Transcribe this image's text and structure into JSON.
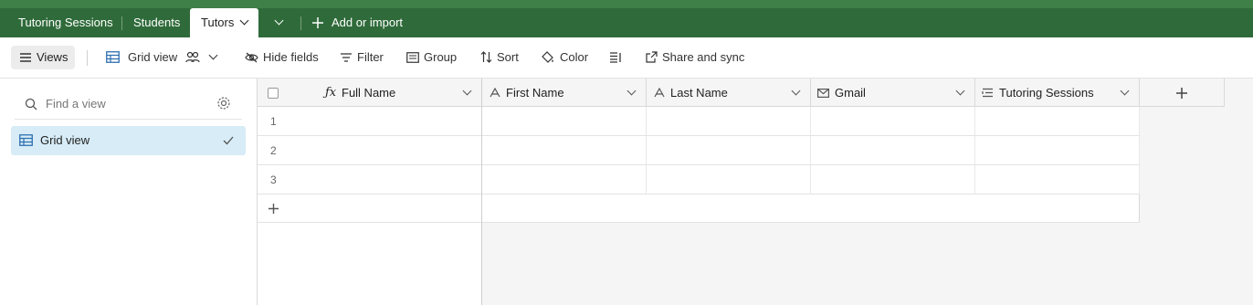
{
  "tabs": [
    {
      "label": "Tutoring Sessions"
    },
    {
      "label": "Students"
    },
    {
      "label": "Tutors"
    }
  ],
  "add_import_label": "Add or import",
  "toolbar": {
    "views_label": "Views",
    "view_name": "Grid view",
    "hide_fields": "Hide fields",
    "filter": "Filter",
    "group": "Group",
    "sort": "Sort",
    "color": "Color",
    "share": "Share and sync"
  },
  "sidebar": {
    "search_placeholder": "Find a view",
    "views": [
      {
        "label": "Grid view"
      }
    ]
  },
  "columns": [
    {
      "label": "Full Name",
      "icon": "formula-icon"
    },
    {
      "label": "First Name",
      "icon": "text-icon"
    },
    {
      "label": "Last Name",
      "icon": "text-icon"
    },
    {
      "label": "Gmail",
      "icon": "email-icon"
    },
    {
      "label": "Tutoring Sessions",
      "icon": "linked-record-icon"
    }
  ],
  "rows": [
    "1",
    "2",
    "3"
  ],
  "colors": {
    "header_green": "#2f6b3a",
    "selected_view": "#d7ecf7"
  }
}
